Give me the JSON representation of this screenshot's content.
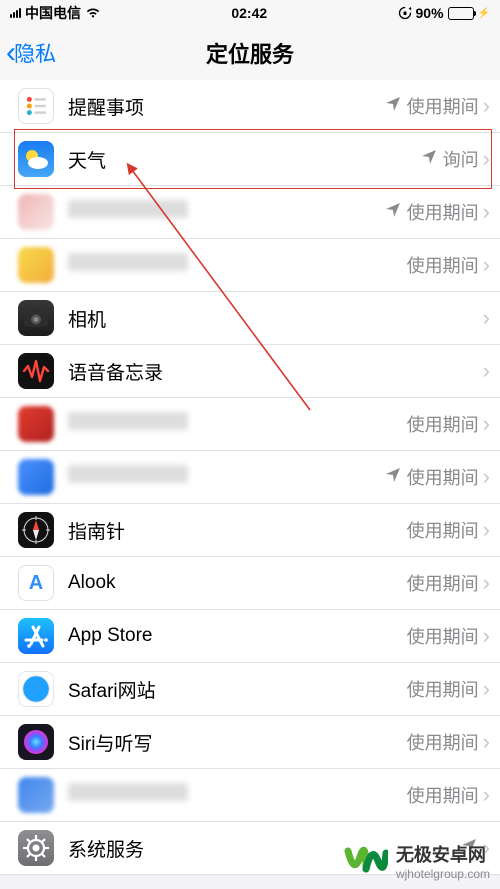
{
  "status": {
    "carrier": "中国电信",
    "time": "02:42",
    "battery_pct": "90%"
  },
  "nav": {
    "back_label": "隐私",
    "title": "定位服务"
  },
  "values": {
    "while_using": "使用期间",
    "ask": "询问"
  },
  "rows": [
    {
      "id": "reminders",
      "label": "提醒事项",
      "status": "while_using",
      "loc": true,
      "icon": "ic-reminders"
    },
    {
      "id": "weather",
      "label": "天气",
      "status": "ask",
      "loc": true,
      "icon": "ic-weather",
      "highlight": true
    },
    {
      "id": "blur1",
      "label": "",
      "status": "while_using",
      "loc": true,
      "icon": "pix pix1",
      "blurred": true
    },
    {
      "id": "blur2",
      "label": "",
      "status": "while_using",
      "loc": false,
      "icon": "pix pix2",
      "blurred": true
    },
    {
      "id": "camera",
      "label": "相机",
      "status": "",
      "loc": false,
      "icon": "ic-camera"
    },
    {
      "id": "voice",
      "label": "语音备忘录",
      "status": "",
      "loc": false,
      "icon": "ic-voice"
    },
    {
      "id": "blur3",
      "label": "",
      "status": "while_using",
      "loc": false,
      "icon": "pix pix3",
      "blurred": true
    },
    {
      "id": "blur4",
      "label": "",
      "status": "while_using",
      "loc": true,
      "icon": "pix pix4",
      "blurred": true
    },
    {
      "id": "compass",
      "label": "指南针",
      "status": "while_using",
      "loc": false,
      "icon": "ic-compass"
    },
    {
      "id": "alook",
      "label": "Alook",
      "status": "while_using",
      "loc": false,
      "icon": "ic-alook"
    },
    {
      "id": "appstore",
      "label": "App Store",
      "status": "while_using",
      "loc": false,
      "icon": "ic-appstore"
    },
    {
      "id": "safari",
      "label": "Safari网站",
      "status": "while_using",
      "loc": false,
      "icon": "ic-safari"
    },
    {
      "id": "siri",
      "label": "Siri与听写",
      "status": "while_using",
      "loc": false,
      "icon": "ic-siri"
    },
    {
      "id": "blur5",
      "label": "",
      "status": "while_using",
      "loc": false,
      "icon": "pix pix5",
      "blurred": true
    },
    {
      "id": "system",
      "label": "系统服务",
      "status": "",
      "loc": true,
      "icon": "ic-system"
    }
  ],
  "watermark": {
    "brand": "无极安卓网",
    "domain": "wjhotelgroup.com"
  }
}
